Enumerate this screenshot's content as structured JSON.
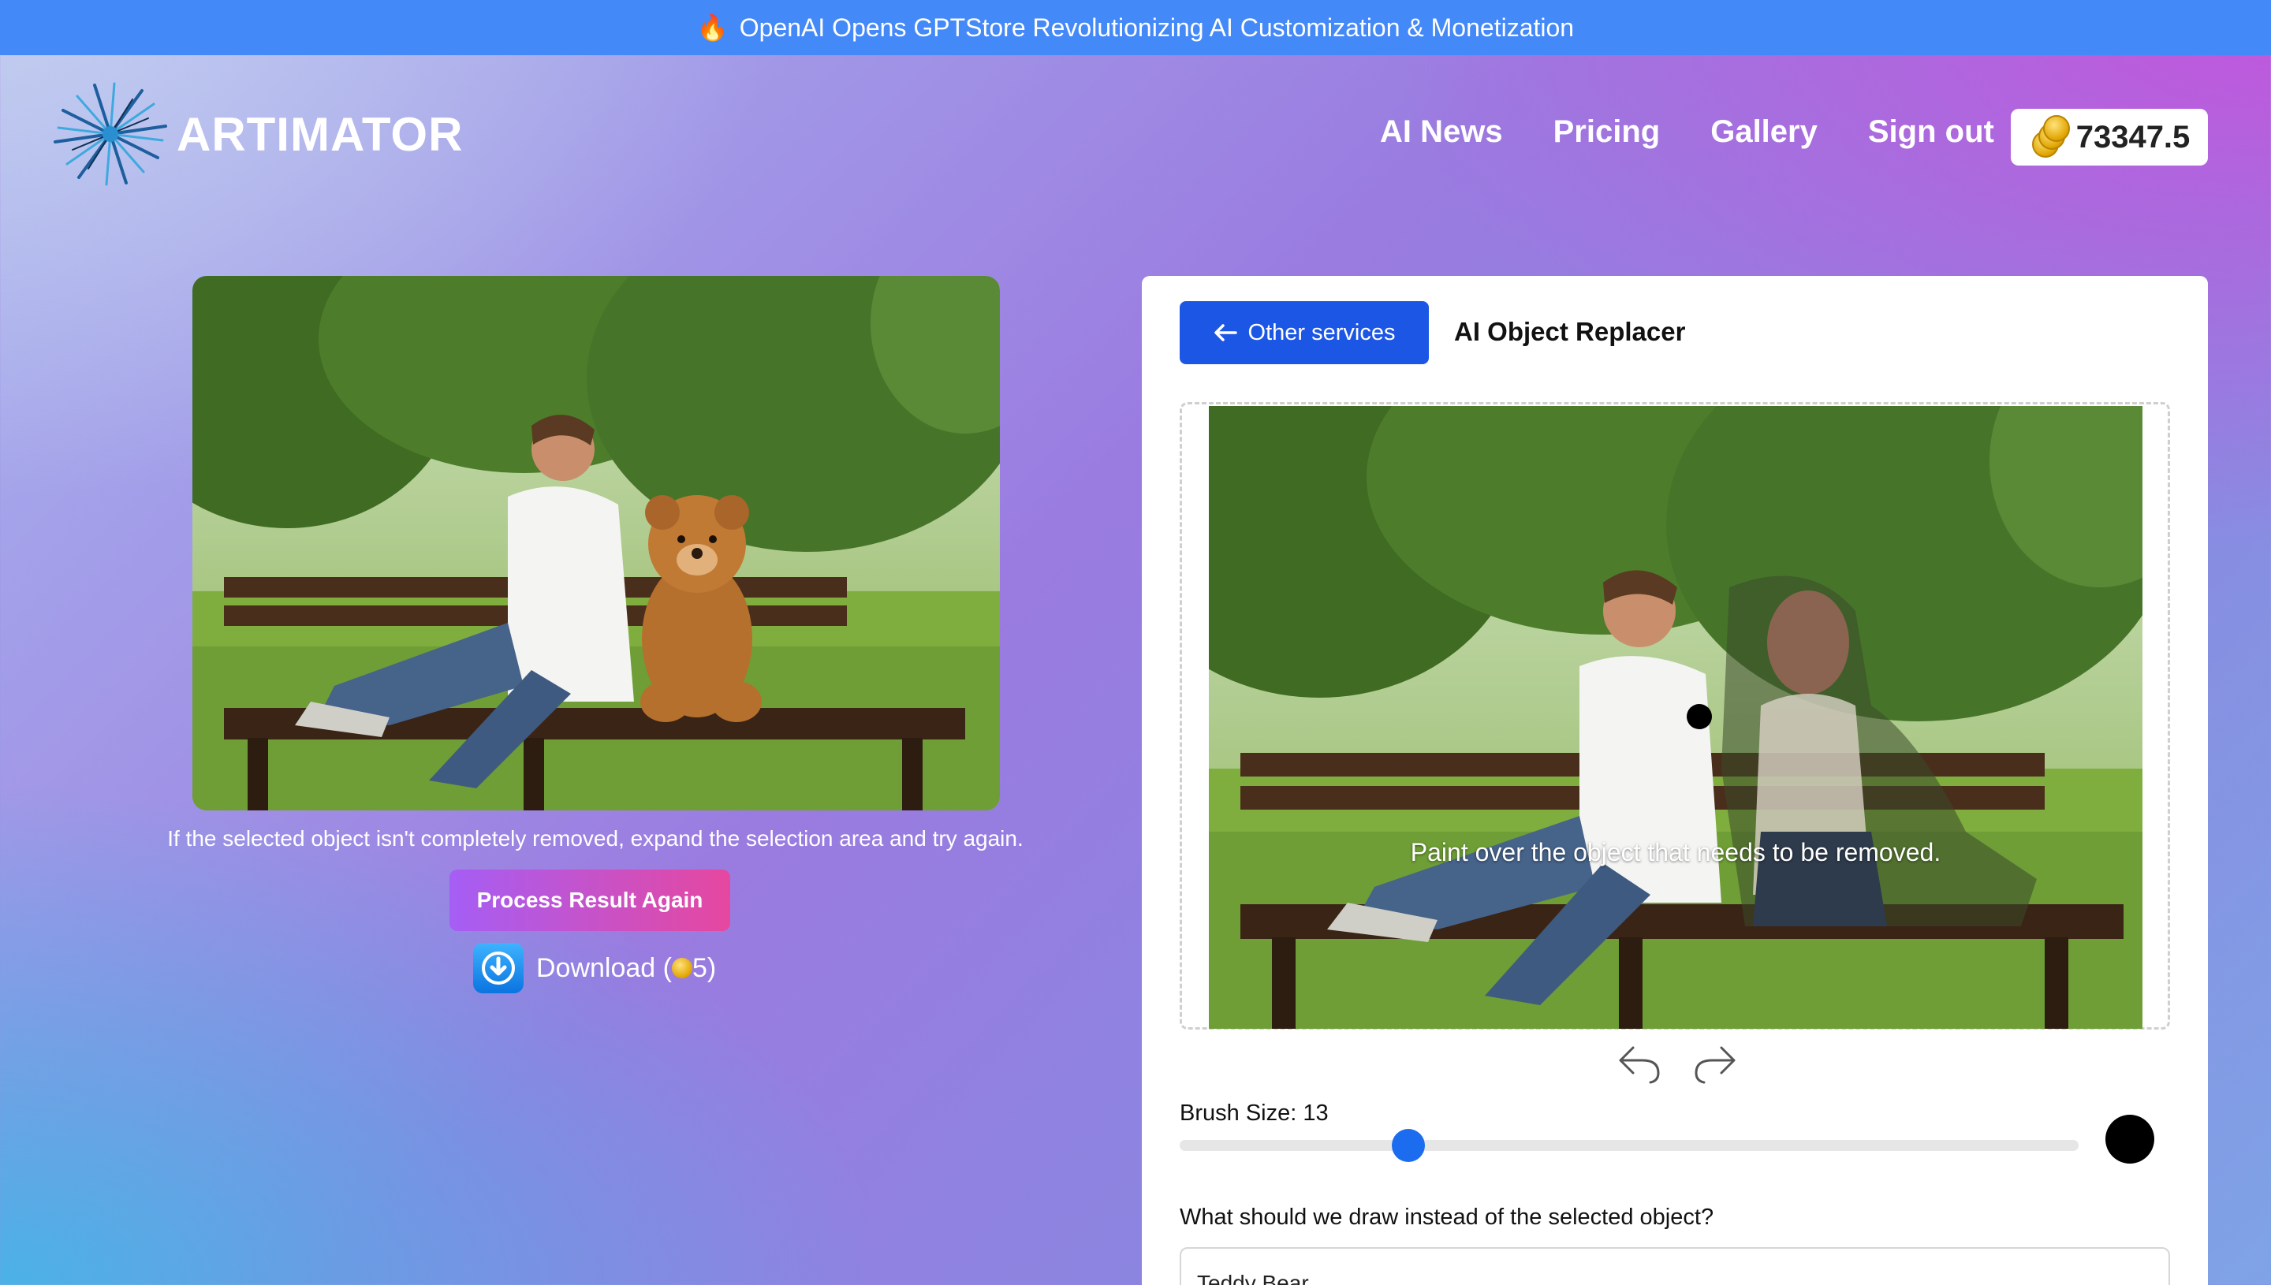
{
  "announcement": {
    "icon": "fire-icon",
    "text": "OpenAI Opens GPTStore Revolutionizing AI Customization & Monetization"
  },
  "header": {
    "brand": "ARTIMATOR",
    "nav": [
      "AI News",
      "Pricing",
      "Gallery",
      "Sign out"
    ],
    "credits": "73347.5"
  },
  "result": {
    "hint": "If the selected object isn't completely removed, expand the selection area and try again.",
    "process_label": "Process Result Again",
    "download_label": "Download (",
    "download_cost": "5)"
  },
  "editor": {
    "back_label": "Other services",
    "title": "AI Object Replacer",
    "paint_hint": "Paint over the object that needs to be removed.",
    "brush_label": "Brush Size: 13",
    "brush_size": 13,
    "brush_min": 1,
    "brush_max": 50,
    "prompt_label": "What should we draw instead of the selected object?",
    "prompt_value": "Teddy Bear"
  },
  "colors": {
    "announcement": "#4489f8",
    "primary_button": "#1c56e4",
    "slider_thumb": "#1c6cf0"
  }
}
